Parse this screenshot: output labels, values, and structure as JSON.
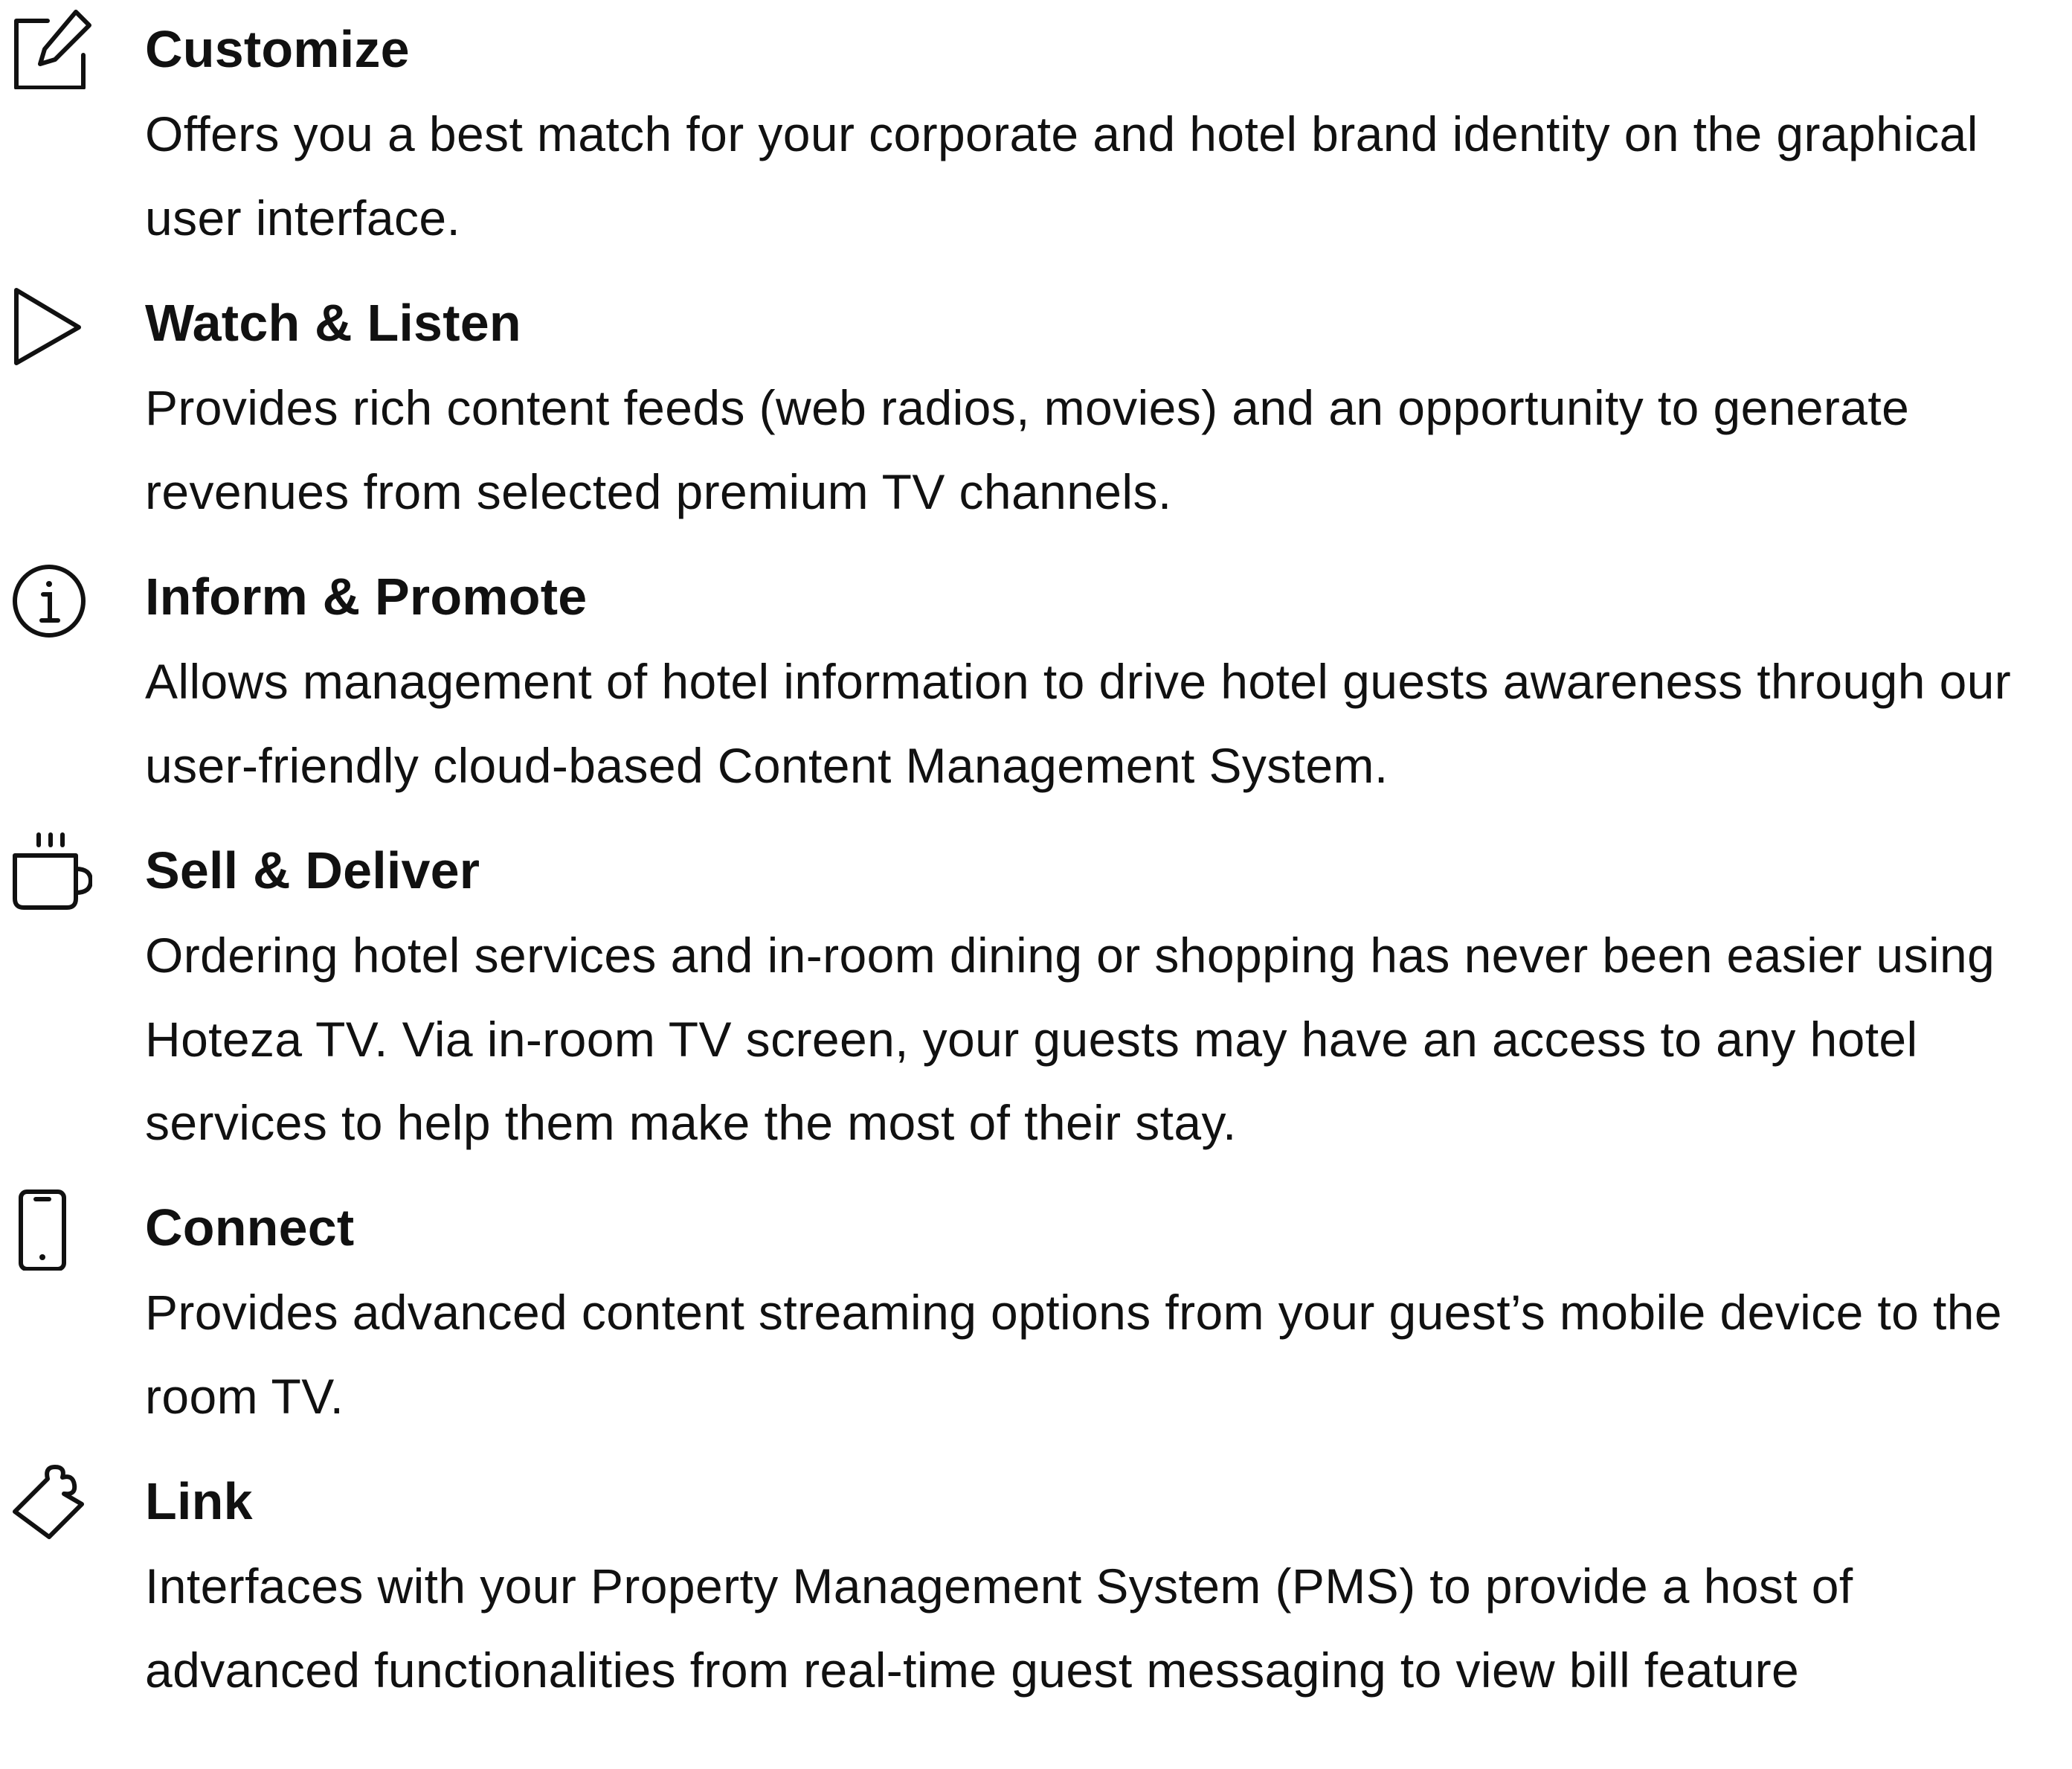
{
  "features": [
    {
      "icon": "edit-icon",
      "title": "Customize",
      "description": "Offers you a best match for your corporate and hotel brand identity on the graphical user interface."
    },
    {
      "icon": "play-icon",
      "title": "Watch & Listen",
      "description": "Provides rich content feeds (web radios, movies) and an opportunity to generate revenues from selected premium TV channels."
    },
    {
      "icon": "info-icon",
      "title": "Inform & Promote",
      "description": "Allows management of hotel information to drive hotel guests awareness through our user-friendly cloud-based Content Management System."
    },
    {
      "icon": "coffee-cup-icon",
      "title": "Sell & Deliver",
      "description": "Ordering hotel services and in-room dining or shopping has never been easier using Hoteza TV. Via in-room TV screen, your guests may have an access to any hotel services to help them make the most of their stay."
    },
    {
      "icon": "smartphone-icon",
      "title": "Connect",
      "description": "Provides advanced content streaming options from your guest’s mobile device to the room TV."
    },
    {
      "icon": "puzzle-piece-icon",
      "title": "Link",
      "description": "Interfaces with your Property Management System (PMS) to provide a host of advanced functionalities from real-time guest messaging to view bill feature"
    }
  ]
}
